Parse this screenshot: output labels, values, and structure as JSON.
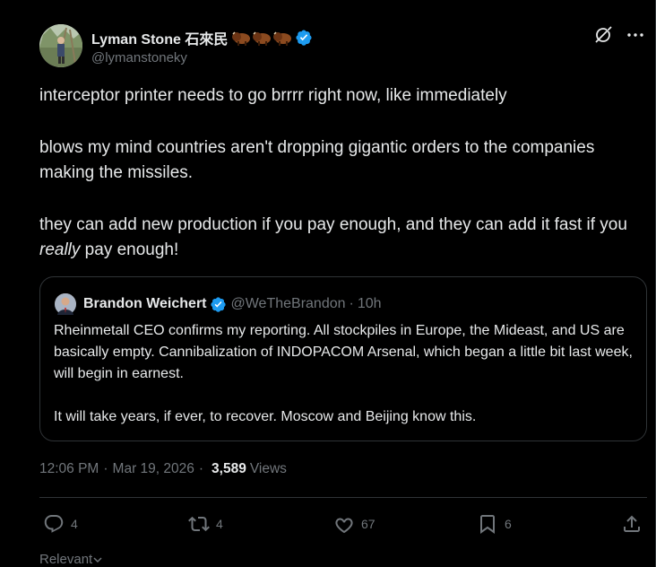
{
  "author": {
    "name": "Lyman Stone 石來民",
    "handle": "@lymanstoneky",
    "emoji_icons": [
      "bison-emoji",
      "bison-emoji",
      "bison-emoji"
    ]
  },
  "tweet": {
    "line1": "interceptor printer needs to go brrrr right now, like immediately",
    "line2": "blows my mind countries aren't dropping gigantic orders to the companies making the missiles.",
    "line3_pre": "they can add new production if you pay enough, and they can add it fast if you ",
    "line3_em": "really",
    "line3_post": " pay enough!"
  },
  "quote": {
    "name": "Brandon Weichert",
    "handle": "@WeTheBrandon",
    "separator": "·",
    "time": "10h",
    "para1": "Rheinmetall CEO confirms my reporting. All stockpiles in Europe, the Mideast, and US are basically empty. Cannibalization of INDOPACOM Arsenal, which began a little bit last week, will begin in earnest.",
    "para2": "It will take years, if ever, to recover. Moscow and Beijing know this."
  },
  "meta": {
    "time": "12:06 PM",
    "dot": "·",
    "date": "Mar 19, 2026",
    "views_count": "3,589",
    "views_label": "Views"
  },
  "actions": {
    "replies": "4",
    "reposts": "4",
    "likes": "67",
    "bookmarks": "6"
  },
  "sort": {
    "label": "Relevant"
  },
  "colors": {
    "background": "#000000",
    "text": "#e7e9ea",
    "muted": "#71767b",
    "border": "#2f3336",
    "verified": "#1d9bf0"
  }
}
